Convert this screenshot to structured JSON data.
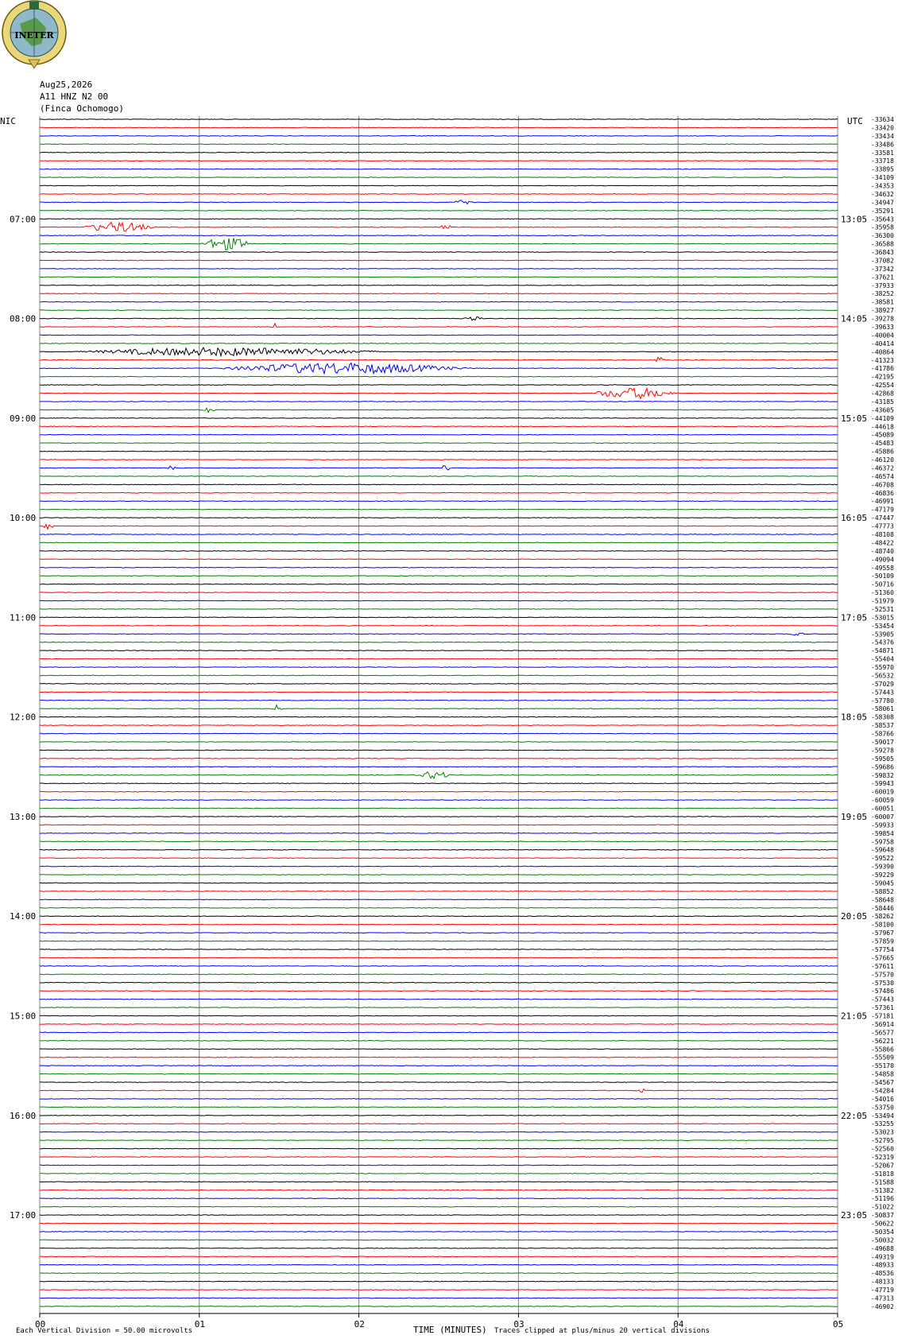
{
  "header": {
    "logo_text": "INETER",
    "date": "Aug25,2026",
    "station": "A11 HNZ N2 00",
    "location": "(Finca Ochomogo)",
    "left_tz": "NIC",
    "right_tz": "UTC"
  },
  "footer": {
    "scale_note": "Each Vertical Division =    50.00 microvolts",
    "clip_note": "Traces clipped at plus/minus 20 vertical divisions"
  },
  "chart_data": {
    "type": "line",
    "title": "",
    "xlabel": "TIME (MINUTES)",
    "ylabel": "",
    "xlim": [
      0,
      5
    ],
    "x_ticks": [
      "00",
      "01",
      "02",
      "03",
      "04",
      "05"
    ],
    "trace_colors": [
      "#000000",
      "#ff0000",
      "#0000ff",
      "#008000"
    ],
    "left_hour_labels": [
      "07:00",
      "08:00",
      "09:00",
      "10:00",
      "11:00",
      "12:00",
      "13:00",
      "14:00",
      "15:00",
      "16:00",
      "17:00"
    ],
    "right_hour_labels": [
      "13:05",
      "14:05",
      "15:05",
      "16:05",
      "17:05",
      "18:05",
      "19:05",
      "20:05",
      "21:05",
      "22:05",
      "23:05"
    ],
    "hour_label_rows": [
      12,
      24,
      36,
      48,
      60,
      72,
      84,
      96,
      108,
      120,
      132
    ],
    "trace_offsets": [
      -33634,
      -33420,
      -33434,
      -33486,
      -33581,
      -33718,
      -33895,
      -34109,
      -34353,
      -34632,
      -34947,
      -35291,
      -35643,
      -35958,
      -36300,
      -36588,
      -36843,
      -37082,
      -37342,
      -37621,
      -37933,
      -38252,
      -38581,
      -38927,
      -39278,
      -39633,
      -40004,
      -40414,
      -40864,
      -41323,
      -41786,
      -42195,
      -42554,
      -42868,
      -43185,
      -43605,
      -44109,
      -44618,
      -45089,
      -45483,
      -45886,
      -46120,
      -46372,
      -46574,
      -46708,
      -46836,
      -46991,
      -47179,
      -47447,
      -47773,
      -48108,
      -48422,
      -48740,
      -49094,
      -49558,
      -50109,
      -50716,
      -51360,
      -51979,
      -52531,
      -53015,
      -53454,
      -53905,
      -54376,
      -54871,
      -55404,
      -55970,
      -56532,
      -57029,
      -57443,
      -57780,
      -58061,
      -58308,
      -58537,
      -58766,
      -59017,
      -59278,
      -59505,
      -59686,
      -59832,
      -59943,
      -60019,
      -60059,
      -60051,
      -60007,
      -59933,
      -59854,
      -59758,
      -59648,
      -59522,
      -59390,
      -59229,
      -59045,
      -58852,
      -58648,
      -58446,
      -58262,
      -58100,
      -57967,
      -57859,
      -57754,
      -57665,
      -57611,
      -57570,
      -57530,
      -57486,
      -57443,
      -57361,
      -57181,
      -56914,
      -56577,
      -56221,
      -55866,
      -55509,
      -55170,
      -54858,
      -54567,
      -54284,
      -54016,
      -53750,
      -53494,
      -53255,
      -53023,
      -52795,
      -52560,
      -52319,
      -52067,
      -51818,
      -51588,
      -51382,
      -51196,
      -51022,
      -50837,
      -50622,
      -50354,
      -50032,
      -49688,
      -49319,
      -48933,
      -48536,
      -48133,
      -47719,
      -47313,
      -46902
    ],
    "events": [
      {
        "row": 10,
        "start_min": 2.58,
        "end_min": 2.78,
        "amp": 3
      },
      {
        "row": 13,
        "start_min": 0.25,
        "end_min": 0.95,
        "amp": 7
      },
      {
        "row": 13,
        "start_min": 2.48,
        "end_min": 2.65,
        "amp": 3
      },
      {
        "row": 15,
        "start_min": 1.0,
        "end_min": 1.5,
        "amp": 9
      },
      {
        "row": 24,
        "start_min": 2.65,
        "end_min": 2.85,
        "amp": 3
      },
      {
        "row": 25,
        "start_min": 1.45,
        "end_min": 1.5,
        "amp": 6
      },
      {
        "row": 28,
        "start_min": 0.2,
        "end_min": 3.05,
        "amp": 6
      },
      {
        "row": 29,
        "start_min": 3.85,
        "end_min": 3.95,
        "amp": 5
      },
      {
        "row": 30,
        "start_min": 1.1,
        "end_min": 3.4,
        "amp": 8
      },
      {
        "row": 33,
        "start_min": 3.45,
        "end_min": 4.25,
        "amp": 8
      },
      {
        "row": 35,
        "start_min": 1.0,
        "end_min": 1.15,
        "amp": 4
      },
      {
        "row": 42,
        "start_min": 0.8,
        "end_min": 0.88,
        "amp": 4
      },
      {
        "row": 42,
        "start_min": 2.52,
        "end_min": 2.6,
        "amp": 6
      },
      {
        "row": 49,
        "start_min": 0.02,
        "end_min": 0.12,
        "amp": 6
      },
      {
        "row": 62,
        "start_min": 4.7,
        "end_min": 4.85,
        "amp": 3
      },
      {
        "row": 71,
        "start_min": 1.45,
        "end_min": 1.55,
        "amp": 5
      },
      {
        "row": 79,
        "start_min": 2.35,
        "end_min": 2.7,
        "amp": 5
      },
      {
        "row": 117,
        "start_min": 3.75,
        "end_min": 3.82,
        "amp": 3
      }
    ]
  }
}
